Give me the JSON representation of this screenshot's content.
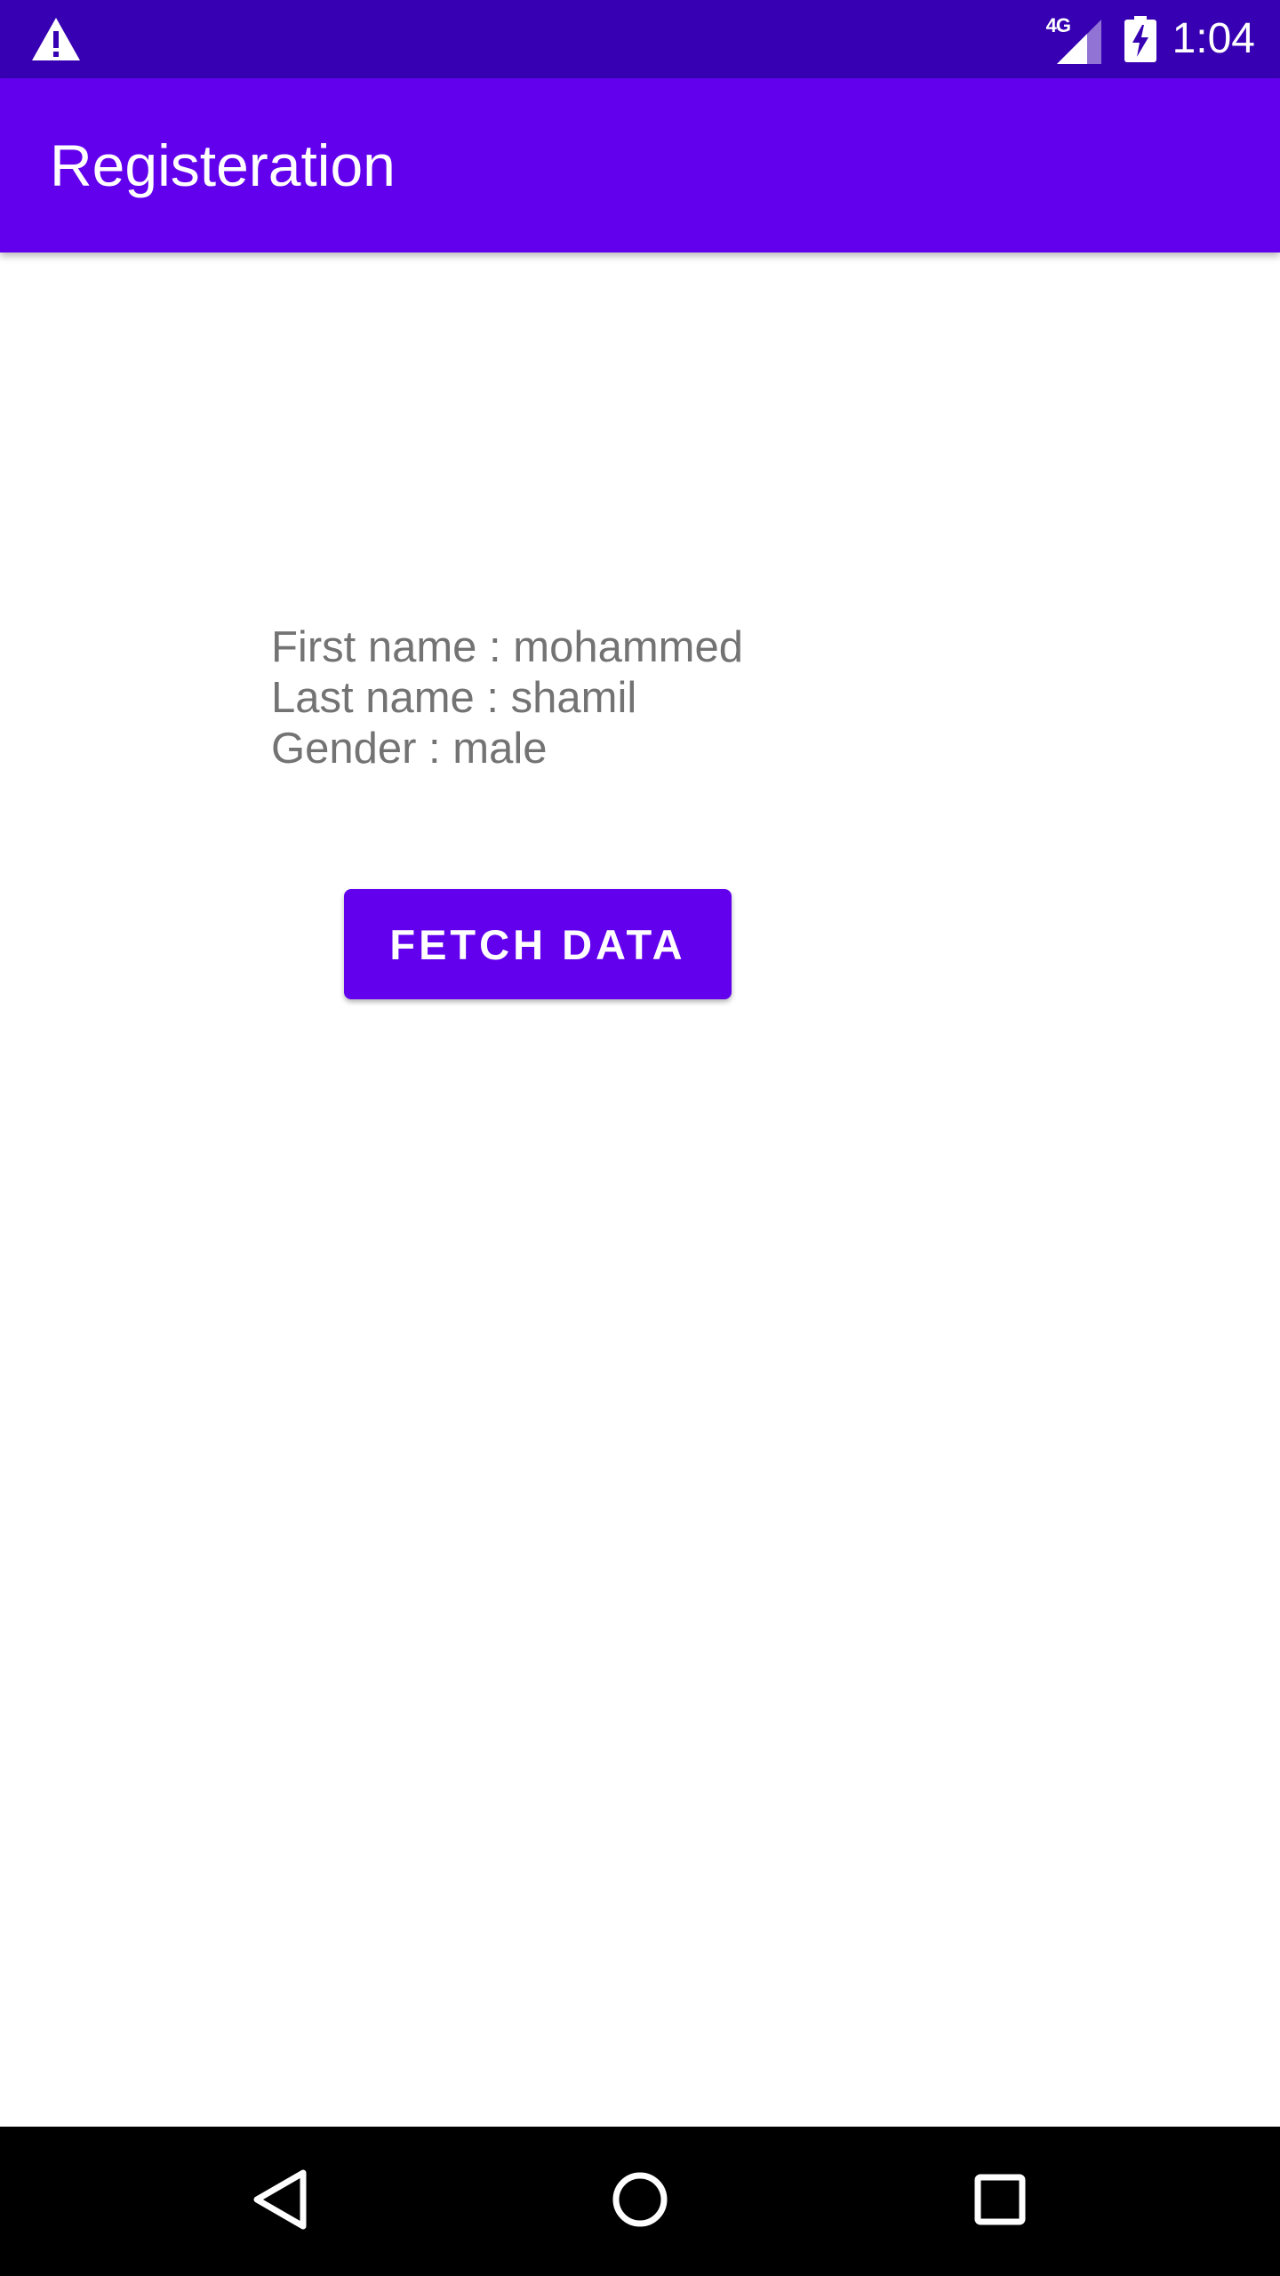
{
  "status_bar": {
    "time": "1:04",
    "network_type": "4G",
    "icons": [
      "warning-icon",
      "signal-icon",
      "battery-charging-icon"
    ],
    "background_color": "#3700B3"
  },
  "app_bar": {
    "title": "Registeration",
    "background_color": "#6200EE"
  },
  "main": {
    "first_name_line": "First name : mohammed",
    "last_name_line": "Last name : shamil",
    "gender_line": "Gender : male",
    "fetch_button_label": "FETCH DATA",
    "text_color": "#737373"
  },
  "nav_bar": {
    "icons": [
      "back-icon",
      "home-icon",
      "recents-icon"
    ]
  }
}
